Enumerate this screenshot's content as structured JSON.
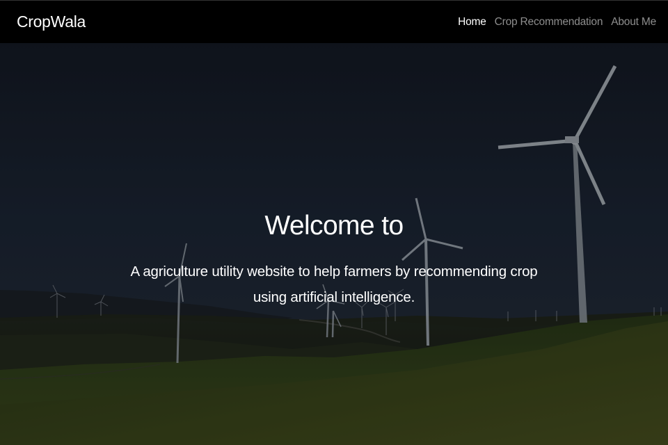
{
  "navbar": {
    "brand": "CropWala",
    "links": [
      {
        "label": "Home",
        "active": true
      },
      {
        "label": "Crop Recommendation",
        "active": false
      },
      {
        "label": "About Me",
        "active": false
      }
    ]
  },
  "hero": {
    "title": "Welcome to",
    "subtitle": "A agriculture utility website to help farmers by recommending crop using artificial intelligence."
  },
  "colors": {
    "navbar_bg": "#000000",
    "nav_active": "#ffffff",
    "nav_inactive": "#8e8e8e",
    "sky": "#1b2432",
    "grass": "#3a4a1e"
  }
}
